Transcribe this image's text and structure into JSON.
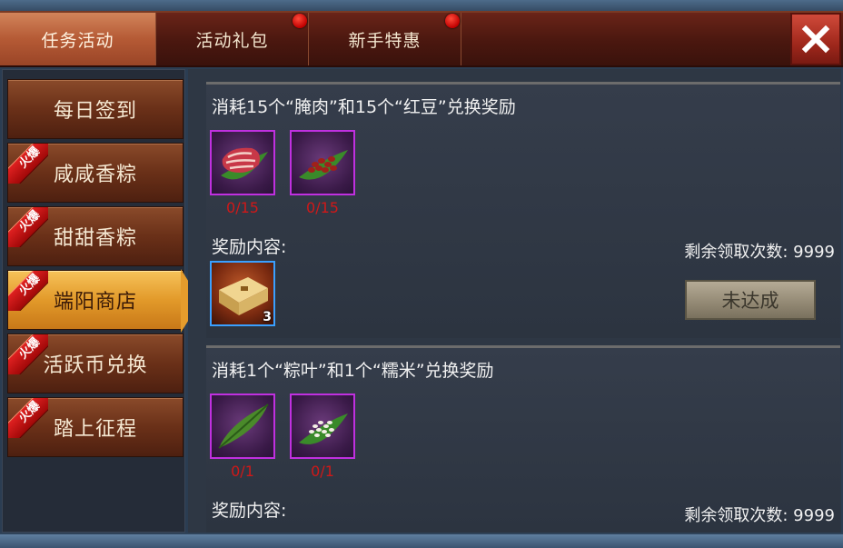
{
  "tabs": [
    {
      "label": "任务活动",
      "active": true,
      "has_dot": false
    },
    {
      "label": "活动礼包",
      "active": false,
      "has_dot": true
    },
    {
      "label": "新手特惠",
      "active": false,
      "has_dot": true
    }
  ],
  "close_icon": "close-x-icon",
  "hot_badge": "火爆",
  "sidebar": {
    "items": [
      {
        "label": "每日签到",
        "hot": false,
        "active": false
      },
      {
        "label": "咸咸香粽",
        "hot": true,
        "active": false
      },
      {
        "label": "甜甜香粽",
        "hot": true,
        "active": false
      },
      {
        "label": "端阳商店",
        "hot": true,
        "active": true
      },
      {
        "label": "活跃币兑换",
        "hot": true,
        "active": false
      },
      {
        "label": "踏上征程",
        "hot": true,
        "active": false
      }
    ]
  },
  "exchanges": [
    {
      "title": "消耗15个“腌肉”和15个“红豆”兑换奖励",
      "materials": [
        {
          "icon": "cured-meat-icon",
          "count": "0/15"
        },
        {
          "icon": "red-beans-icon",
          "count": "0/15"
        }
      ],
      "reward_label": "奖励内容:",
      "reward": {
        "icon": "gold-chest-icon",
        "qty": "3"
      },
      "remaining": "剩余领取次数: 9999",
      "button": "未达成"
    },
    {
      "title": "消耗1个“粽叶”和1个“糯米”兑换奖励",
      "materials": [
        {
          "icon": "bamboo-leaf-icon",
          "count": "0/1"
        },
        {
          "icon": "glutinous-rice-icon",
          "count": "0/1"
        }
      ],
      "reward_label": "奖励内容:",
      "remaining": "剩余领取次数: 9999"
    }
  ],
  "colors": {
    "accent_gold": "#e29a2a",
    "tab_active": "#b55a35",
    "count_red": "#d01818",
    "slot_purple": "#c030e0"
  }
}
